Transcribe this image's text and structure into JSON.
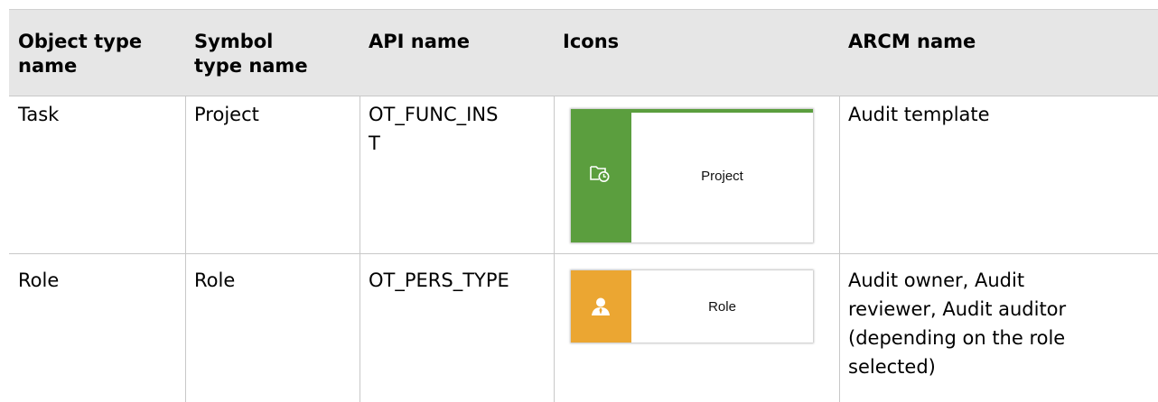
{
  "table": {
    "headers": [
      "Object type name",
      "Symbol type name",
      "API name",
      "Icons",
      "ARCM name"
    ],
    "header_lines": [
      [
        "Object type",
        "name"
      ],
      [
        "Symbol",
        "type name"
      ],
      [
        "API name"
      ],
      [
        "Icons"
      ],
      [
        "ARCM name"
      ]
    ],
    "rows": [
      {
        "object_type": "Task",
        "symbol_type": "Project",
        "api_name_lines": [
          "OT_FUNC_INS",
          "T"
        ],
        "icon": {
          "name": "project-folder-clock-icon",
          "label": "Project",
          "color": "#5b9e3e"
        },
        "arcm_lines": [
          "Audit template"
        ]
      },
      {
        "object_type": "Role",
        "symbol_type": "Role",
        "api_name_lines": [
          "OT_PERS_TYPE"
        ],
        "icon": {
          "name": "person-icon",
          "label": "Role",
          "color": "#eba632"
        },
        "arcm_lines": [
          "Audit owner, Audit",
          "reviewer, Audit auditor",
          "(depending on the role",
          "selected)"
        ]
      }
    ]
  },
  "colors": {
    "header_bg": "#e6e6e6",
    "grid": "#c8c8c8"
  }
}
